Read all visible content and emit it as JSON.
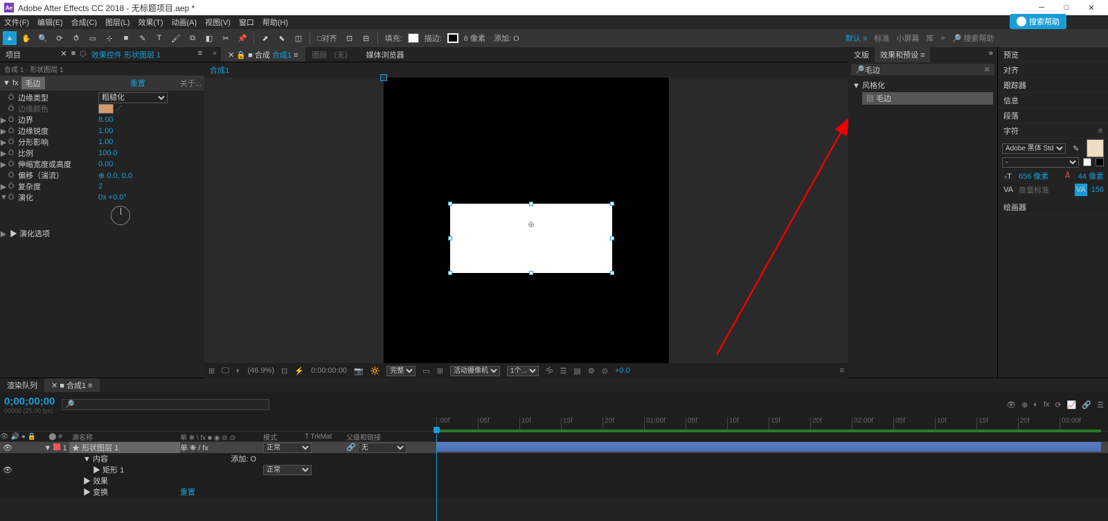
{
  "window": {
    "title": "Adobe After Effects CC 2018 - 无标题项目.aep *",
    "cloud_button": "搜索帮助"
  },
  "menubar": [
    "文件(F)",
    "编辑(E)",
    "合成(C)",
    "图层(L)",
    "效果(T)",
    "动画(A)",
    "视图(V)",
    "窗口",
    "帮助(H)"
  ],
  "toptool": {
    "snap": "□对齐",
    "fill_label": "填充:",
    "stroke_label": "描边:",
    "stroke_px_label": "6 像素",
    "add_label": "添加: O",
    "workspaces": [
      "默认 ≡",
      "标准",
      "小屏幕",
      "库"
    ],
    "search_label": "搜索帮助"
  },
  "left": {
    "tabs": [
      "项目"
    ],
    "fx_tab": "效果控件 形状图层 1",
    "breadcrumb": "合成 1 · 形状图层 1",
    "fx_prefix": "▼ fx",
    "fx_name": "毛边",
    "reset": "重置",
    "about": "关于...",
    "props": [
      {
        "tri": "",
        "name": "边缘类型",
        "type": "select",
        "val": "粗糙化"
      },
      {
        "tri": "",
        "name": "边缘颜色",
        "type": "color"
      },
      {
        "tri": "▶",
        "name": "边界",
        "val": "8.00"
      },
      {
        "tri": "▶",
        "name": "边缘锐度",
        "val": "1.00"
      },
      {
        "tri": "▶",
        "name": "分形影响",
        "val": "1.00"
      },
      {
        "tri": "▶",
        "name": "比例",
        "val": "100.0"
      },
      {
        "tri": "▶",
        "name": "伸缩宽度或高度",
        "val": "0.00"
      },
      {
        "tri": "",
        "name": "偏移（湍流）",
        "val": "⊕ 0.0, 0.0"
      },
      {
        "tri": "▶",
        "name": "复杂度",
        "val": "2"
      },
      {
        "tri": "▼",
        "name": "演化",
        "val": "0x +0.0°"
      }
    ],
    "evo_options": "▶ 演化选项"
  },
  "center": {
    "tabs": [
      {
        "label_prefix": "■ 合成 ",
        "label_link": "合成1",
        "link": true
      },
      {
        "label": "图层 （无）",
        "dim": true
      },
      {
        "label": "媒体浏览器",
        "dim": false
      }
    ],
    "bread": "合成1",
    "footer": {
      "zoom": "(46.9%)",
      "timecode": "0:00:00:00",
      "res": "完整",
      "camera": "活动摄像机",
      "view1": "1个...",
      "exposure": "+0.0"
    }
  },
  "right": {
    "tabs": [
      "文版",
      "效果和预设 ≡"
    ],
    "search": "毛边",
    "cat": "▼ 风格化",
    "item": "毛边",
    "panels": [
      "预览",
      "对齐",
      "跟踪器",
      "信息",
      "段落",
      "字符"
    ],
    "char": {
      "font": "Adobe 黑体 Std",
      "size_label": "656 像素",
      "leading_label": "44 像素",
      "kerning_label": "度量标准",
      "tracking_label": "156"
    },
    "last_panel": "绘画器"
  },
  "timeline": {
    "tabs": [
      "渲染队列",
      "■ 合成1 ≡"
    ],
    "timecode": "0;00;00;00",
    "fps": "00000 (25.00 fps)",
    "ruler": [
      ":00f",
      "05f",
      "10f",
      "15f",
      "20f",
      "01:00f",
      "05f",
      "10f",
      "15f",
      "20f",
      "02:00f",
      "05f",
      "10f",
      "15f",
      "20f",
      "03:00f"
    ],
    "cols": {
      "num": "#",
      "src": "源名称",
      "switches": "单 ❋ \\ fx ■ ◉ ⊘ ⊙",
      "mode": "模式",
      "trkmat": "T  TrkMat",
      "parent": "父级和链接"
    },
    "add_label": "添加: O",
    "rows": [
      {
        "eye": true,
        "num": "1",
        "name": "形状图层 1",
        "switches": "单 ❋ / fx",
        "mode": "正常",
        "parent": "无",
        "sel": true
      },
      {
        "eye": "",
        "tri": "▼",
        "name": "内容"
      },
      {
        "eye": true,
        "tri": "▶",
        "name": "矩形 1",
        "mode": "正常"
      },
      {
        "eye": "",
        "tri": "▶",
        "name": "效果"
      },
      {
        "eye": "",
        "tri": "▶",
        "name": "变换",
        "reset": "重置"
      }
    ]
  }
}
